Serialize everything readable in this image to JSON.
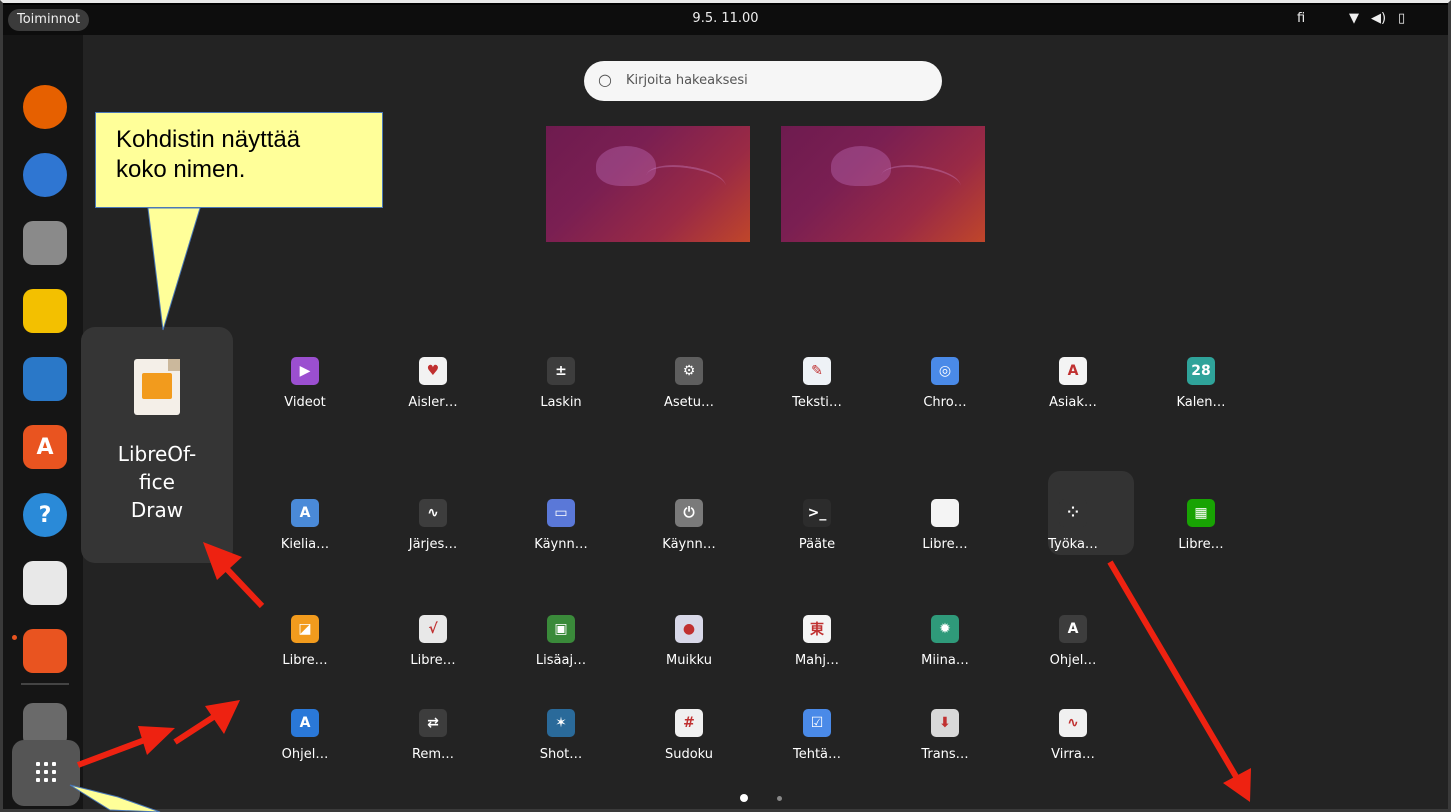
{
  "topbar": {
    "activities_label": "Toiminnot",
    "clock": "9.5. 11.00",
    "keyboard_layout": "fi",
    "tray_icons": [
      "wifi-icon",
      "volume-icon",
      "battery-icon"
    ]
  },
  "dock": {
    "items": [
      {
        "name": "firefox-icon",
        "color": "#e66000"
      },
      {
        "name": "thunderbird-icon",
        "color": "#2f76d2"
      },
      {
        "name": "files-icon",
        "color": "#8a8a8a"
      },
      {
        "name": "rhythmbox-icon",
        "color": "#f3c000"
      },
      {
        "name": "libreoffice-writer-icon",
        "color": "#2a78c8"
      },
      {
        "name": "ubuntu-software-icon",
        "color": "#e95420"
      },
      {
        "name": "help-icon",
        "color": "#2a8ad8"
      },
      {
        "name": "image-viewer-icon",
        "color": "#e8e8e8"
      },
      {
        "name": "libreoffice-impress-icon",
        "color": "#e95420"
      },
      {
        "name": "removable-drive-icon",
        "color": "#6a6a6a"
      }
    ],
    "show_apps_label": ""
  },
  "search": {
    "placeholder": "Kirjoita hakeaksesi"
  },
  "focused_app": {
    "name": "LibreOf-\nfice\nDraw"
  },
  "apps": [
    {
      "label": "Videot",
      "icon": "videos-icon",
      "color": "#9b4fd0",
      "glyph": "▶"
    },
    {
      "label": "Aisler…",
      "icon": "aisleriot-icon",
      "color": "#f2f2f2",
      "glyph": "♥"
    },
    {
      "label": "Laskin",
      "icon": "calculator-icon",
      "color": "#3d3d3d",
      "glyph": "±"
    },
    {
      "label": "Asetu…",
      "icon": "settings-icon",
      "color": "#5e5e5e",
      "glyph": "⚙"
    },
    {
      "label": "Teksti…",
      "icon": "text-editor-icon",
      "color": "#eef2f6",
      "glyph": "✎"
    },
    {
      "label": "Chro…",
      "icon": "chromium-icon",
      "color": "#4a8ae8",
      "glyph": "◎"
    },
    {
      "label": "Asiak…",
      "icon": "document-viewer-icon",
      "color": "#f4f4f4",
      "glyph": "A"
    },
    {
      "label": "Kalen…",
      "icon": "calendar-icon",
      "color": "#2fa39a",
      "glyph": "28"
    },
    {
      "label": "Kielia…",
      "icon": "language-support-icon",
      "color": "#4a8ad8",
      "glyph": "A"
    },
    {
      "label": "Järjes…",
      "icon": "system-monitor-icon",
      "color": "#3d3d3d",
      "glyph": "∿"
    },
    {
      "label": "Käynn…",
      "icon": "startup-disk-icon",
      "color": "#5a78d8",
      "glyph": "▭"
    },
    {
      "label": "Käynn…",
      "icon": "startup-applications-icon",
      "color": "#7a7a7a",
      "glyph": "⏻"
    },
    {
      "label": "Pääte",
      "icon": "terminal-icon",
      "color": "#2c2c2c",
      "glyph": ">_"
    },
    {
      "label": "Libre…",
      "icon": "libreoffice-icon",
      "color": "#f4f4f4",
      "glyph": ""
    },
    {
      "label": "Työka…",
      "icon": "utilities-folder-icon",
      "color": "#333333",
      "glyph": "⁘"
    },
    {
      "label": "Libre…",
      "icon": "libreoffice-calc-icon",
      "color": "#18a303",
      "glyph": "▦"
    },
    {
      "label": "Libre…",
      "icon": "libreoffice-draw-icon",
      "color": "#f29b1d",
      "glyph": "◪"
    },
    {
      "label": "Libre…",
      "icon": "libreoffice-math-icon",
      "color": "#e8e8e8",
      "glyph": "√"
    },
    {
      "label": "Lisäaj…",
      "icon": "additional-drivers-icon",
      "color": "#3a8a3a",
      "glyph": "▣"
    },
    {
      "label": "Muikku",
      "icon": "cheese-icon",
      "color": "#d8d8e8",
      "glyph": "●"
    },
    {
      "label": "Mahj…",
      "icon": "mahjongg-icon",
      "color": "#f4f4f4",
      "glyph": "東"
    },
    {
      "label": "Miina…",
      "icon": "mines-icon",
      "color": "#2f9a7a",
      "glyph": "✹"
    },
    {
      "label": "Ohjel…",
      "icon": "software-updater-icon",
      "color": "#3d3d3d",
      "glyph": "A"
    },
    {
      "label": "Ohjel…",
      "icon": "software-properties-icon",
      "color": "#2a78d8",
      "glyph": "A"
    },
    {
      "label": "Rem…",
      "icon": "remmina-icon",
      "color": "#3d3d3d",
      "glyph": "⇄"
    },
    {
      "label": "Shot…",
      "icon": "shotwell-icon",
      "color": "#2a6a9a",
      "glyph": "✶"
    },
    {
      "label": "Sudoku",
      "icon": "sudoku-icon",
      "color": "#f0f0f0",
      "glyph": "#"
    },
    {
      "label": "Tehtä…",
      "icon": "todo-icon",
      "color": "#4a8ae8",
      "glyph": "☑"
    },
    {
      "label": "Trans…",
      "icon": "transmission-icon",
      "color": "#d8d8d8",
      "glyph": "⬇"
    },
    {
      "label": "Virra…",
      "icon": "power-statistics-icon",
      "color": "#f0f0f0",
      "glyph": "∿"
    }
  ],
  "pagination": {
    "pages": 2,
    "current": 1
  },
  "annotation": {
    "callout_text": "Kohdistin näyttää\nkoko nimen.",
    "arrow_color": "#ee2211"
  }
}
